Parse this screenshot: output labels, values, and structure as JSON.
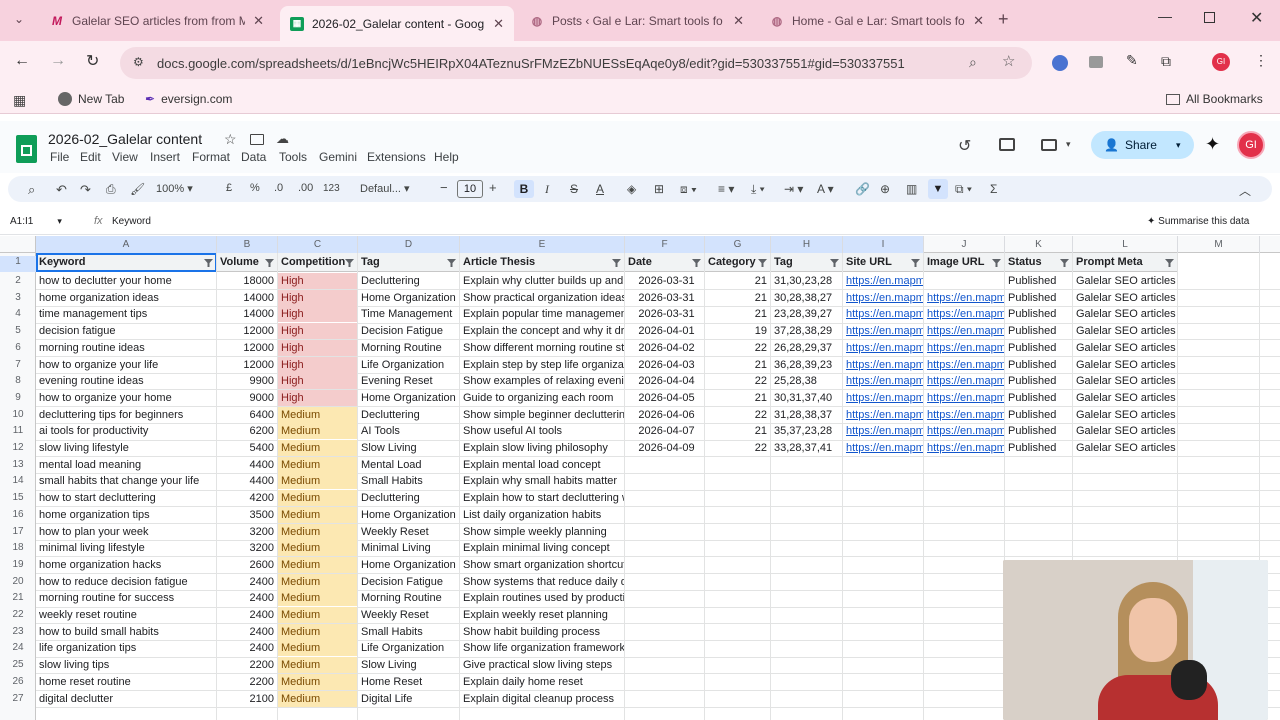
{
  "browser": {
    "tabs": [
      {
        "title": "Galelar SEO articles from from M",
        "icon": "m-icon",
        "active": false
      },
      {
        "title": "2026-02_Galelar content - Goog",
        "icon": "sheets-icon",
        "active": true
      },
      {
        "title": "Posts ‹ Gal e Lar: Smart tools fo",
        "icon": "wordpress-icon",
        "active": false
      },
      {
        "title": "Home - Gal e Lar: Smart tools fo",
        "icon": "site-icon",
        "active": false
      }
    ],
    "url": "docs.google.com/spreadsheets/d/1eBncjWc5HEIRpX04ATeznuSrFMzEZbNUESsEqAqe0y8/edit?gid=530337551#gid=530337551",
    "bookmarks": [
      "New Tab",
      "eversign.com"
    ],
    "all_bookmarks": "All Bookmarks"
  },
  "sheet": {
    "title": "2026-02_Galelar content",
    "menus": [
      "File",
      "Edit",
      "View",
      "Insert",
      "Format",
      "Data",
      "Tools",
      "Gemini",
      "Extensions",
      "Help"
    ],
    "share": "Share",
    "avatar": "GI",
    "zoom": "100%",
    "currency": "£",
    "percent": "%",
    "dec_less": ".0",
    "dec_more": ".00",
    "num_format": "123",
    "font": "Defaul...",
    "font_size": "10",
    "cell_ref": "A1:I1",
    "formula": "Keyword",
    "summarise": "Summarise this data",
    "columns": [
      "A",
      "B",
      "C",
      "D",
      "E",
      "F",
      "G",
      "H",
      "I",
      "J",
      "K",
      "L",
      "M"
    ],
    "headers": [
      "Keyword",
      "Volume",
      "Competition",
      "Tag",
      "Article Thesis",
      "Date",
      "Category",
      "Tag",
      "Site URL",
      "Image URL",
      "Status",
      "Prompt Meta"
    ],
    "rows": [
      {
        "n": "2",
        "kw": "how to declutter your home",
        "vol": "18000",
        "comp": "High",
        "tag": "Decluttering",
        "thesis": "Explain why clutter builds up and p",
        "date": "2026-03-31",
        "cat": "21",
        "tag2": "31,30,23,28",
        "site": "https://en.mapm",
        "img": "",
        "status": "Published",
        "meta": "Galelar SEO articles f"
      },
      {
        "n": "3",
        "kw": "home organization ideas",
        "vol": "14000",
        "comp": "High",
        "tag": "Home Organization",
        "thesis": "Show practical organization ideas",
        "date": "2026-03-31",
        "cat": "21",
        "tag2": "30,28,38,27",
        "site": "https://en.mapm",
        "img": "https://en.mapm",
        "status": "Published",
        "meta": "Galelar SEO articles f"
      },
      {
        "n": "4",
        "kw": "time management tips",
        "vol": "14000",
        "comp": "High",
        "tag": "Time Management",
        "thesis": "Explain popular time management",
        "date": "2026-03-31",
        "cat": "21",
        "tag2": "23,28,39,27",
        "site": "https://en.mapm",
        "img": "https://en.mapm",
        "status": "Published",
        "meta": "Galelar SEO articles f"
      },
      {
        "n": "5",
        "kw": "decision fatigue",
        "vol": "12000",
        "comp": "High",
        "tag": "Decision Fatigue",
        "thesis": "Explain the concept and why it dra",
        "date": "2026-04-01",
        "cat": "19",
        "tag2": "37,28,38,29",
        "site": "https://en.mapm",
        "img": "https://en.mapm",
        "status": "Published",
        "meta": "Galelar SEO articles f"
      },
      {
        "n": "6",
        "kw": "morning routine ideas",
        "vol": "12000",
        "comp": "High",
        "tag": "Morning Routine",
        "thesis": "Show different morning routine str",
        "date": "2026-04-02",
        "cat": "22",
        "tag2": "26,28,29,37",
        "site": "https://en.mapm",
        "img": "https://en.mapm",
        "status": "Published",
        "meta": "Galelar SEO articles f"
      },
      {
        "n": "7",
        "kw": "how to organize your life",
        "vol": "12000",
        "comp": "High",
        "tag": "Life Organization",
        "thesis": "Explain step by step life organizati",
        "date": "2026-04-03",
        "cat": "21",
        "tag2": "36,28,39,23",
        "site": "https://en.mapm",
        "img": "https://en.mapm",
        "status": "Published",
        "meta": "Galelar SEO articles f"
      },
      {
        "n": "8",
        "kw": "evening routine ideas",
        "vol": "9900",
        "comp": "High",
        "tag": "Evening Reset",
        "thesis": "Show examples of relaxing evenin",
        "date": "2026-04-04",
        "cat": "22",
        "tag2": "25,28,38",
        "site": "https://en.mapm",
        "img": "https://en.mapm",
        "status": "Published",
        "meta": "Galelar SEO articles f"
      },
      {
        "n": "9",
        "kw": "how to organize your home",
        "vol": "9000",
        "comp": "High",
        "tag": "Home Organization",
        "thesis": "Guide to organizing each room",
        "date": "2026-04-05",
        "cat": "21",
        "tag2": "30,31,37,40",
        "site": "https://en.mapm",
        "img": "https://en.mapm",
        "status": "Published",
        "meta": "Galelar SEO articles f"
      },
      {
        "n": "10",
        "kw": "decluttering tips for beginners",
        "vol": "6400",
        "comp": "Medium",
        "tag": "Decluttering",
        "thesis": "Show simple beginner decluttering",
        "date": "2026-04-06",
        "cat": "22",
        "tag2": "31,28,38,37",
        "site": "https://en.mapm",
        "img": "https://en.mapm",
        "status": "Published",
        "meta": "Galelar SEO articles f"
      },
      {
        "n": "11",
        "kw": "ai tools for productivity",
        "vol": "6200",
        "comp": "Medium",
        "tag": "AI Tools",
        "thesis": "Show useful AI tools",
        "date": "2026-04-07",
        "cat": "21",
        "tag2": "35,37,23,28",
        "site": "https://en.mapm",
        "img": "https://en.mapm",
        "status": "Published",
        "meta": "Galelar SEO articles f"
      },
      {
        "n": "12",
        "kw": "slow living lifestyle",
        "vol": "5400",
        "comp": "Medium",
        "tag": "Slow Living",
        "thesis": "Explain slow living philosophy",
        "date": "2026-04-09",
        "cat": "22",
        "tag2": "33,28,37,41",
        "site": "https://en.mapm",
        "img": "https://en.mapm",
        "status": "Published",
        "meta": "Galelar SEO articles f"
      },
      {
        "n": "13",
        "kw": "mental load meaning",
        "vol": "4400",
        "comp": "Medium",
        "tag": "Mental Load",
        "thesis": "Explain mental load concept",
        "date": "",
        "cat": "",
        "tag2": "",
        "site": "",
        "img": "",
        "status": "",
        "meta": ""
      },
      {
        "n": "14",
        "kw": "small habits that change your life",
        "vol": "4400",
        "comp": "Medium",
        "tag": "Small Habits",
        "thesis": "Explain why small habits matter",
        "date": "",
        "cat": "",
        "tag2": "",
        "site": "",
        "img": "",
        "status": "",
        "meta": ""
      },
      {
        "n": "15",
        "kw": "how to start decluttering",
        "vol": "4200",
        "comp": "Medium",
        "tag": "Decluttering",
        "thesis": "Explain how to start decluttering w",
        "date": "",
        "cat": "",
        "tag2": "",
        "site": "",
        "img": "",
        "status": "",
        "meta": ""
      },
      {
        "n": "16",
        "kw": "home organization tips",
        "vol": "3500",
        "comp": "Medium",
        "tag": "Home Organization",
        "thesis": "List daily organization habits",
        "date": "",
        "cat": "",
        "tag2": "",
        "site": "",
        "img": "",
        "status": "",
        "meta": ""
      },
      {
        "n": "17",
        "kw": "how to plan your week",
        "vol": "3200",
        "comp": "Medium",
        "tag": "Weekly Reset",
        "thesis": "Show simple weekly planning",
        "date": "",
        "cat": "",
        "tag2": "",
        "site": "",
        "img": "",
        "status": "",
        "meta": ""
      },
      {
        "n": "18",
        "kw": "minimal living lifestyle",
        "vol": "3200",
        "comp": "Medium",
        "tag": "Minimal Living",
        "thesis": "Explain minimal living concept",
        "date": "",
        "cat": "",
        "tag2": "",
        "site": "",
        "img": "",
        "status": "",
        "meta": ""
      },
      {
        "n": "19",
        "kw": "home organization hacks",
        "vol": "2600",
        "comp": "Medium",
        "tag": "Home Organization",
        "thesis": "Show smart organization shortcuts",
        "date": "",
        "cat": "",
        "tag2": "",
        "site": "",
        "img": "",
        "status": "",
        "meta": ""
      },
      {
        "n": "20",
        "kw": "how to reduce decision fatigue",
        "vol": "2400",
        "comp": "Medium",
        "tag": "Decision Fatigue",
        "thesis": "Show systems that reduce daily de",
        "date": "",
        "cat": "",
        "tag2": "",
        "site": "",
        "img": "",
        "status": "",
        "meta": ""
      },
      {
        "n": "21",
        "kw": "morning routine for success",
        "vol": "2400",
        "comp": "Medium",
        "tag": "Morning Routine",
        "thesis": "Explain routines used by productiv",
        "date": "",
        "cat": "",
        "tag2": "",
        "site": "",
        "img": "",
        "status": "",
        "meta": ""
      },
      {
        "n": "22",
        "kw": "weekly reset routine",
        "vol": "2400",
        "comp": "Medium",
        "tag": "Weekly Reset",
        "thesis": "Explain weekly reset planning",
        "date": "",
        "cat": "",
        "tag2": "",
        "site": "",
        "img": "",
        "status": "",
        "meta": ""
      },
      {
        "n": "23",
        "kw": "how to build small habits",
        "vol": "2400",
        "comp": "Medium",
        "tag": "Small Habits",
        "thesis": "Show habit building process",
        "date": "",
        "cat": "",
        "tag2": "",
        "site": "",
        "img": "",
        "status": "",
        "meta": ""
      },
      {
        "n": "24",
        "kw": "life organization tips",
        "vol": "2400",
        "comp": "Medium",
        "tag": "Life Organization",
        "thesis": "Show life organization framework",
        "date": "",
        "cat": "",
        "tag2": "",
        "site": "",
        "img": "",
        "status": "",
        "meta": ""
      },
      {
        "n": "25",
        "kw": "slow living tips",
        "vol": "2200",
        "comp": "Medium",
        "tag": "Slow Living",
        "thesis": "Give practical slow living steps",
        "date": "",
        "cat": "",
        "tag2": "",
        "site": "",
        "img": "",
        "status": "",
        "meta": ""
      },
      {
        "n": "26",
        "kw": "home reset routine",
        "vol": "2200",
        "comp": "Medium",
        "tag": "Home Reset",
        "thesis": "Explain daily home reset",
        "date": "",
        "cat": "",
        "tag2": "",
        "site": "",
        "img": "",
        "status": "",
        "meta": ""
      },
      {
        "n": "27",
        "kw": "digital declutter",
        "vol": "2100",
        "comp": "Medium",
        "tag": "Digital Life",
        "thesis": "Explain digital cleanup process",
        "date": "",
        "cat": "",
        "tag2": "",
        "site": "",
        "img": "",
        "status": "",
        "meta": ""
      }
    ]
  },
  "colors": {
    "high": "#f4cccc",
    "medium": "#fce8b2",
    "accent": "#0b57d0",
    "sheets_green": "#0f9d58"
  }
}
